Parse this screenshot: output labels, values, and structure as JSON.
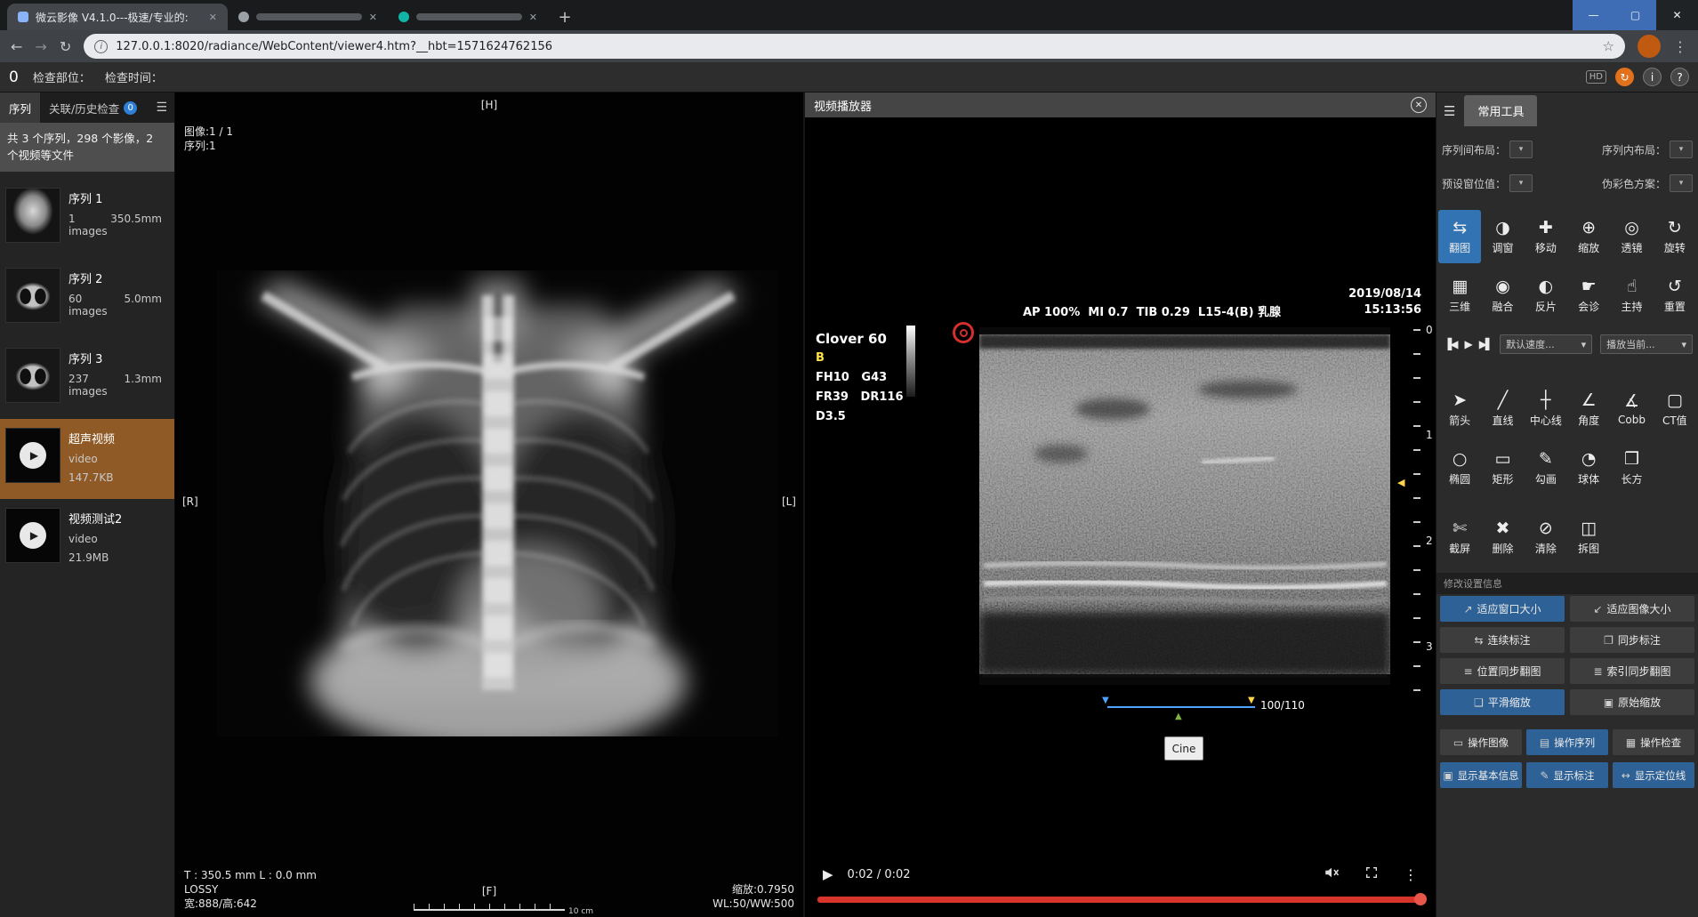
{
  "browser": {
    "tab1_title": "微云影像 V4.1.0---极速/专业的:",
    "url": "127.0.0.1:8020/radiance/WebContent/viewer4.htm?__hbt=1571624762156",
    "icons": {
      "back": "←",
      "forward": "→",
      "reload": "↻",
      "star": "☆",
      "menu": "⋮",
      "plus": "+",
      "close": "✕",
      "minimize": "—",
      "maximize": "▢",
      "info": "i"
    }
  },
  "app_bar": {
    "count": "0",
    "part_label": "检查部位：",
    "time_label": "检查时间：",
    "hd": "HD",
    "refresh": "↻",
    "info": "i",
    "help": "?"
  },
  "glyphs": {
    "menu": "☰",
    "caret": "▾",
    "down": "▼",
    "up": "▲",
    "left": "◀"
  },
  "sidebar": {
    "tab_series": "序列",
    "tab_history": "关联/历史检查",
    "history_badge": "0",
    "summary": "共 3 个序列，298 个影像，2 个视频等文件",
    "play_glyph": "▶",
    "items": [
      {
        "title": "序列 1",
        "count": "1 images",
        "size": "350.5mm"
      },
      {
        "title": "序列 2",
        "count": "60 images",
        "size": "5.0mm"
      },
      {
        "title": "序列 3",
        "count": "237 images",
        "size": "1.3mm"
      },
      {
        "title": "超声视频",
        "count": "video",
        "size": "147.7KB"
      },
      {
        "title": "视频测试2",
        "count": "video",
        "size": "21.9MB"
      }
    ]
  },
  "viewer": {
    "marker_top": "[H]",
    "marker_left": "[R]",
    "marker_right": "[L]",
    "marker_bottom": "[F]",
    "image_index": "图像:1 / 1",
    "series_index": "序列:1",
    "measure": "T : 350.5 mm L : 0.0 mm",
    "lossy": "LOSSY",
    "dimensions": "宽:888/高:642",
    "zoom": "缩放:0.7950",
    "window": "WL:50/WW:500",
    "ruler": "10 cm"
  },
  "video": {
    "title": "视频播放器",
    "close": "✕",
    "header": "AP 100%  MI 0.7  TIB 0.29  L15-4(B) 乳腺",
    "date": "2019/08/14",
    "time": "15:13:56",
    "device": "Clover 60",
    "mode": "B",
    "param1": "FH10   G43",
    "param2": "FR39   DR116",
    "param3": "D3.5",
    "ticks": [
      "0",
      "1",
      "2",
      "3"
    ],
    "frame": "100/110",
    "cine": "Cine",
    "clock": "0:02 / 0:02",
    "play": "▶",
    "more": "⋮"
  },
  "tools": {
    "tab": "常用工具",
    "dropdowns": [
      {
        "label": "序列间布局："
      },
      {
        "label": "序列内布局："
      },
      {
        "label": "预设窗位值："
      },
      {
        "label": "伪彩色方案："
      }
    ],
    "main": [
      {
        "label": "翻图",
        "glyph": "⇆",
        "active": true
      },
      {
        "label": "调窗",
        "glyph": "◑"
      },
      {
        "label": "移动",
        "glyph": "✚"
      },
      {
        "label": "缩放",
        "glyph": "⊕"
      },
      {
        "label": "透镜",
        "glyph": "◎"
      },
      {
        "label": "旋转",
        "glyph": "↻"
      },
      {
        "label": "三维",
        "glyph": "▦"
      },
      {
        "label": "融合",
        "glyph": "◉"
      },
      {
        "label": "反片",
        "glyph": "◐"
      },
      {
        "label": "会诊",
        "glyph": "☛"
      },
      {
        "label": "主持",
        "glyph": "☝"
      },
      {
        "label": "重置",
        "glyph": "↺"
      }
    ],
    "playback": {
      "prev": "▐◀",
      "play": "▶",
      "next": "▶▌",
      "speed": "默认速度...",
      "target": "播放当前..."
    },
    "measure": [
      {
        "label": "箭头",
        "glyph": "➤"
      },
      {
        "label": "直线",
        "glyph": "╱"
      },
      {
        "label": "中心线",
        "glyph": "┼"
      },
      {
        "label": "角度",
        "glyph": "∠"
      },
      {
        "label": "Cobb",
        "glyph": "∡"
      },
      {
        "label": "CT值",
        "glyph": "▢"
      },
      {
        "label": "椭圆",
        "glyph": "○"
      },
      {
        "label": "矩形",
        "glyph": "▭"
      },
      {
        "label": "勾画",
        "glyph": "✎"
      },
      {
        "label": "球体",
        "glyph": "◔"
      },
      {
        "label": "长方",
        "glyph": "❒"
      }
    ],
    "actions": [
      {
        "label": "截屏",
        "glyph": "✄"
      },
      {
        "label": "删除",
        "glyph": "✖"
      },
      {
        "label": "清除",
        "glyph": "⊘"
      },
      {
        "label": "拆图",
        "glyph": "◫"
      }
    ],
    "settings_header": "修改设置信息",
    "settings": [
      {
        "label": "适应窗口大小",
        "glyph": "↗",
        "active": true
      },
      {
        "label": "适应图像大小",
        "glyph": "↙"
      },
      {
        "label": "连续标注",
        "glyph": "⇆"
      },
      {
        "label": "同步标注",
        "glyph": "❐"
      },
      {
        "label": "位置同步翻图",
        "glyph": "≡"
      },
      {
        "label": "索引同步翻图",
        "glyph": "≣"
      },
      {
        "label": "平滑缩放",
        "glyph": "❑",
        "active": true
      },
      {
        "label": "原始缩放",
        "glyph": "▣"
      }
    ],
    "scope": [
      {
        "label": "操作图像",
        "glyph": "▭"
      },
      {
        "label": "操作序列",
        "glyph": "▤",
        "active": true
      },
      {
        "label": "操作检查",
        "glyph": "▦"
      }
    ],
    "display": [
      {
        "label": "显示基本信息",
        "glyph": "▣",
        "active": true
      },
      {
        "label": "显示标注",
        "glyph": "✎",
        "active": true
      },
      {
        "label": "显示定位线",
        "glyph": "↔",
        "active": true
      }
    ]
  },
  "colors": {
    "accent_blue": "#2e6195",
    "tool_active_blue": "#3273b4",
    "selection_orange": "#8f5a26",
    "progress_red": "#d7352b"
  }
}
